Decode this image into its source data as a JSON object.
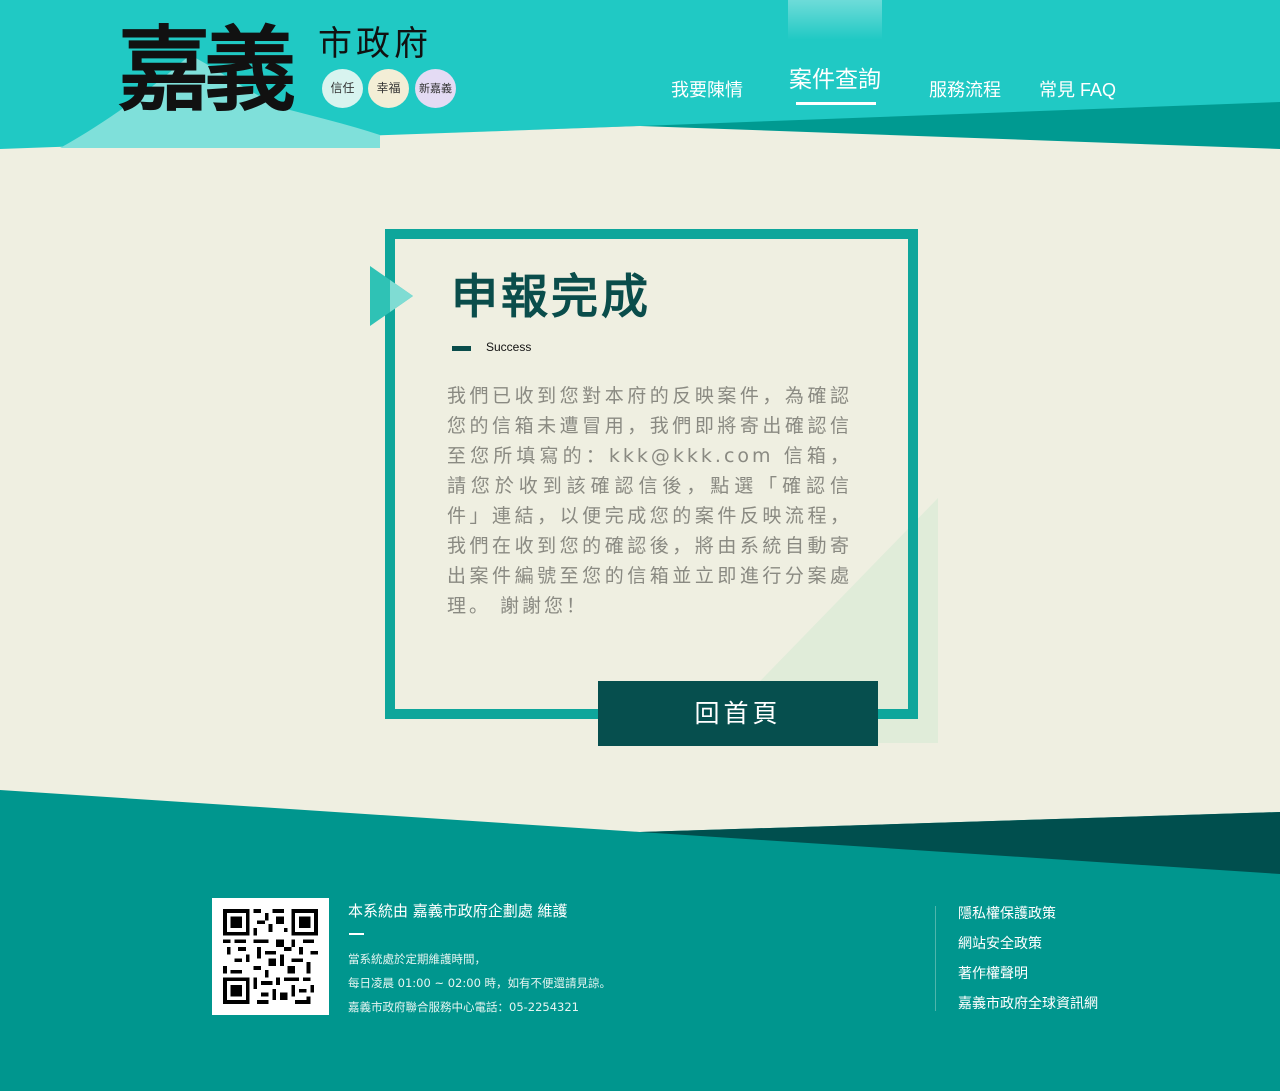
{
  "header": {
    "logo_main": "嘉義",
    "logo_sub": "市政府",
    "badges": [
      "信任",
      "幸福",
      "新嘉義"
    ],
    "nav": [
      {
        "label": "我要陳情",
        "active": false
      },
      {
        "label": "案件查詢",
        "active": true
      },
      {
        "label": "服務流程",
        "active": false
      },
      {
        "label": "常見 FAQ",
        "active": false
      }
    ]
  },
  "card": {
    "title": "申報完成",
    "subtitle": "Success",
    "message": "我們已收到您對本府的反映案件，為確認您的信箱未遭冒用，我們即將寄出確認信至您所填寫的：kkk@kkk.com  信箱，請您於收到該確認信後，點選「確認信件」連結，以便完成您的案件反映流程，我們在收到您的確認後，將由系統自動寄出案件編號至您的信箱並立即進行分案處理。 謝謝您！",
    "button_label": "回首頁"
  },
  "footer": {
    "maintainer": "本系統由 嘉義市政府企劃處 維護",
    "notes": [
      "當系統處於定期維護時間，",
      "每日凌晨 01:00 ~ 02:00 時，如有不便還請見諒。",
      "嘉義市政府聯合服務中心電話：05-2254321"
    ],
    "links": [
      "隱私權保護政策",
      "網站安全政策",
      "著作權聲明",
      "嘉義市政府全球資訊網"
    ]
  },
  "colors": {
    "teal": "#20c9c4",
    "dark_teal": "#00968e",
    "darkest": "#064f4e",
    "frame": "#0ea69b",
    "background": "#efefe1"
  }
}
